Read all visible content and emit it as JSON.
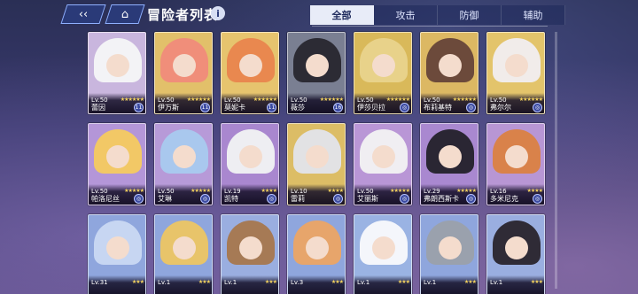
{
  "header": {
    "title": "冒险者列表",
    "back_icon": "back-icon",
    "home_icon": "home-icon"
  },
  "tabs": [
    {
      "label": "全部",
      "active": true
    },
    {
      "label": "攻击",
      "active": false
    },
    {
      "label": "防御",
      "active": false
    },
    {
      "label": "辅助",
      "active": false
    }
  ],
  "cards": [
    {
      "name": "蕾因",
      "level": "Lv.50",
      "stars": "★★★★★★",
      "badge": "11",
      "bg": "#c9b6de",
      "hair": "#f3f3f6"
    },
    {
      "name": "伊万斯",
      "level": "Lv.50",
      "stars": "★★★★★★",
      "badge": "11",
      "bg": "#e2c06a",
      "hair": "#f08e7a"
    },
    {
      "name": "莫妮卡",
      "level": "Lv.50",
      "stars": "★★★★★★",
      "badge": "11",
      "bg": "#e6c46e",
      "hair": "#e9884f"
    },
    {
      "name": "薇莎",
      "level": "Lv.50",
      "stars": "★★★★★★",
      "badge": "16",
      "bg": "#7a7f92",
      "hair": "#2c2b34"
    },
    {
      "name": "伊莎贝拉",
      "level": "Lv.50",
      "stars": "★★★★★★",
      "badge": "◎",
      "bg": "#d9b95a",
      "hair": "#e8d28a"
    },
    {
      "name": "布莉基特",
      "level": "Lv.50",
      "stars": "★★★★★★",
      "badge": "◎",
      "bg": "#dcb863",
      "hair": "#6c4a3b"
    },
    {
      "name": "弗尔尔",
      "level": "Lv.50",
      "stars": "★★★★★★",
      "badge": "◎",
      "bg": "#e3c46b",
      "hair": "#f1ecea"
    },
    {
      "name": "帕洛尼丝",
      "level": "Lv.50",
      "stars": "★★★★★",
      "badge": "◎",
      "bg": "#b496d8",
      "hair": "#f2c866"
    },
    {
      "name": "艾琳",
      "level": "Lv.50",
      "stars": "★★★★★",
      "badge": "◎",
      "bg": "#b79ad8",
      "hair": "#a9c8ee"
    },
    {
      "name": "凯特",
      "level": "Lv.19",
      "stars": "★★★★",
      "badge": "◎",
      "bg": "#a987cf",
      "hair": "#eeeef2"
    },
    {
      "name": "雷莉",
      "level": "Lv.10",
      "stars": "★★★★",
      "badge": "◎",
      "bg": "#dcbd66",
      "hair": "#e2e2e4"
    },
    {
      "name": "艾丽斯",
      "level": "Lv.50",
      "stars": "★★★★★",
      "badge": "◎",
      "bg": "#b996d6",
      "hair": "#f0eef2"
    },
    {
      "name": "弗朗西斯卡",
      "level": "Lv.29",
      "stars": "★★★★★",
      "badge": "◎",
      "bg": "#a988d0",
      "hair": "#2a2633"
    },
    {
      "name": "多米尼克",
      "level": "Lv.16",
      "stars": "★★★★",
      "badge": "◎",
      "bg": "#b896d4",
      "hair": "#d9824a"
    },
    {
      "name": "",
      "level": "Lv.31",
      "stars": "★★★",
      "badge": "",
      "bg": "#8fa6dd",
      "hair": "#c7d6f2"
    },
    {
      "name": "",
      "level": "Lv.1",
      "stars": "★★★",
      "badge": "",
      "bg": "#8fa6dd",
      "hair": "#e8c46a"
    },
    {
      "name": "",
      "level": "Lv.1",
      "stars": "★★★",
      "badge": "",
      "bg": "#9aaee0",
      "hair": "#a67a55"
    },
    {
      "name": "",
      "level": "Lv.3",
      "stars": "★★★",
      "badge": "",
      "bg": "#8fa6dd",
      "hair": "#e7a56b"
    },
    {
      "name": "",
      "level": "Lv.1",
      "stars": "★★★",
      "badge": "",
      "bg": "#9ab3e3",
      "hair": "#f4f6fb"
    },
    {
      "name": "",
      "level": "Lv.1",
      "stars": "★★★",
      "badge": "",
      "bg": "#8fa6dd",
      "hair": "#9aa1ad"
    },
    {
      "name": "",
      "level": "Lv.1",
      "stars": "★★★",
      "badge": "",
      "bg": "#9aaee0",
      "hair": "#2f2b36"
    }
  ]
}
